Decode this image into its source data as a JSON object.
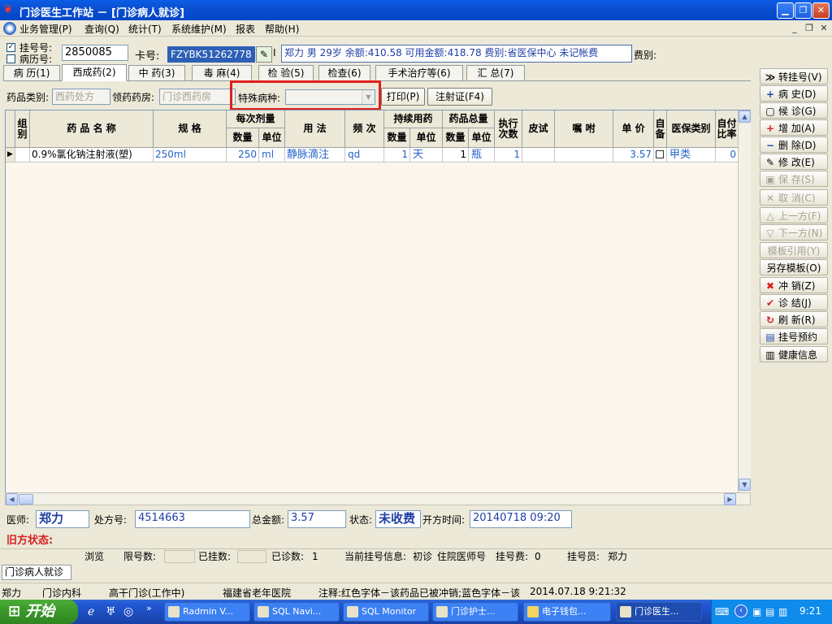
{
  "window": {
    "title": "门诊医生工作站 － [门诊病人就诊]"
  },
  "menu": [
    "业务管理(P)",
    "查询(Q)",
    "统计(T)",
    "系统维护(M)",
    "报表",
    "帮助(H)"
  ],
  "patient": {
    "reg_label": "挂号号:",
    "record_label": "病历号:",
    "reg_no": "2850085",
    "card_label": "卡号:",
    "card_no": "FZYBK51262778",
    "info": "郑力 男 29岁 余额:410.58 可用金额:418.78 费别:省医保中心 未记帐费",
    "fee_label": "费别:"
  },
  "tabs": [
    "病 历(1)",
    "西成药(2)",
    "中 药(3)",
    "毒 麻(4)",
    "检 验(5)",
    "检查(6)",
    "手术治疗等(6)",
    "汇 总(7)"
  ],
  "filters": {
    "drug_type_label": "药品类别:",
    "drug_type_value": "西药处方",
    "pharmacy_label": "领药药房:",
    "pharmacy_value": "门诊西药房",
    "special_label": "特殊病种:",
    "special_value": "",
    "print_label": "打印(P)",
    "injection_label": "注射证(F4)"
  },
  "grid": {
    "headers": {
      "group": "组别",
      "name": "药 品 名 称",
      "spec": "规  格",
      "per_dose": "每次剂量",
      "qty": "数量",
      "unit": "单位",
      "usage": "用 法",
      "freq": "频 次",
      "cont": "持续用药",
      "total": "药品总量",
      "exec": "执行次数",
      "skin": "皮试",
      "note": "嘱 咐",
      "price": "单 价",
      "self": "自备",
      "ins": "医保类别",
      "selfpay": "自付比率"
    },
    "rows": [
      {
        "marker": "▶",
        "name": "0.9%氯化钠注射液(塑)",
        "spec": "250ml",
        "qty": "250",
        "unit": "ml",
        "usage": "静脉滴注",
        "freq": "qd",
        "cont_qty": "1",
        "cont_unit": "天",
        "total_qty": "1",
        "total_unit": "瓶",
        "exec": "1",
        "skin": "",
        "note": "",
        "price": "3.57",
        "ins": "甲类",
        "selfpay": "0"
      }
    ]
  },
  "right_buttons": [
    {
      "icon": "≫",
      "label": "转挂号(V)",
      "enabled": true
    },
    {
      "icon": "+",
      "label": "病  史(D)",
      "enabled": true
    },
    {
      "icon": "▢",
      "label": "候  诊(G)",
      "enabled": true
    },
    {
      "icon": "+",
      "label": "增  加(A)",
      "enabled": true
    },
    {
      "icon": "−",
      "label": "删  除(D)",
      "enabled": true
    },
    {
      "icon": "✎",
      "label": "修  改(E)",
      "enabled": true
    },
    {
      "icon": "▣",
      "label": "保  存(S)",
      "enabled": false
    },
    {
      "icon": "✕",
      "label": "取  消(C)",
      "enabled": false
    },
    {
      "icon": "△",
      "label": "上一方(F)",
      "enabled": false
    },
    {
      "icon": "▽",
      "label": "下一方(N)",
      "enabled": false
    },
    {
      "icon": "",
      "label": "模板引用(Y)",
      "enabled": false
    },
    {
      "icon": "",
      "label": "另存模板(O)",
      "enabled": true
    },
    {
      "icon": "✖",
      "label": "冲  销(Z)",
      "enabled": true
    },
    {
      "icon": "✔",
      "label": "诊  结(J)",
      "enabled": true
    },
    {
      "icon": "↻",
      "label": "刷  新(R)",
      "enabled": true
    },
    {
      "icon": "▤",
      "label": "挂号预约",
      "enabled": true
    },
    {
      "icon": "▥",
      "label": "健康信息",
      "enabled": true
    }
  ],
  "footer": {
    "doctor_label": "医师:",
    "doctor": "郑力",
    "rx_label": "处方号:",
    "rx_no": "4514663",
    "total_label": "总金额:",
    "total": "3.57",
    "state_label": "状态:",
    "state": "未收费",
    "time_label": "开方时间:",
    "time": "20140718 09:20",
    "old_state": "旧方状态:"
  },
  "info_bar": {
    "browse": "浏览",
    "limit_label": "限号数:",
    "registered_label": "已挂数:",
    "seen_label": "已诊数:",
    "seen": "1",
    "current_label": "当前挂号信息:",
    "current_type": "初诊",
    "hosp_doc": "住院医师号",
    "fee_label": "挂号费:",
    "fee": "0",
    "clerk_label": "挂号员:",
    "clerk": "郑力"
  },
  "doc_tab": "门诊病人就诊",
  "status_bar": {
    "user": "郑力",
    "dept": "门诊内科",
    "clinic": "高干门诊(工作中)",
    "hospital": "福建省老年医院",
    "note": "注释:红色字体－该药品已被冲销;蓝色字体－该",
    "datetime": "2014.07.18 9:21:32"
  },
  "taskbar": {
    "start": "开始",
    "tasks": [
      "Radmin V...",
      "SQL Navi...",
      "SQL Monitor",
      "门诊护士...",
      "电子钱包...",
      "门诊医生..."
    ],
    "clock": "9:21"
  },
  "colors": {
    "title_blue": "#0b4fd0",
    "highlight_red": "#e0201f",
    "grid_bg": "#fdf6ee",
    "text_blue": "#2563c8"
  }
}
